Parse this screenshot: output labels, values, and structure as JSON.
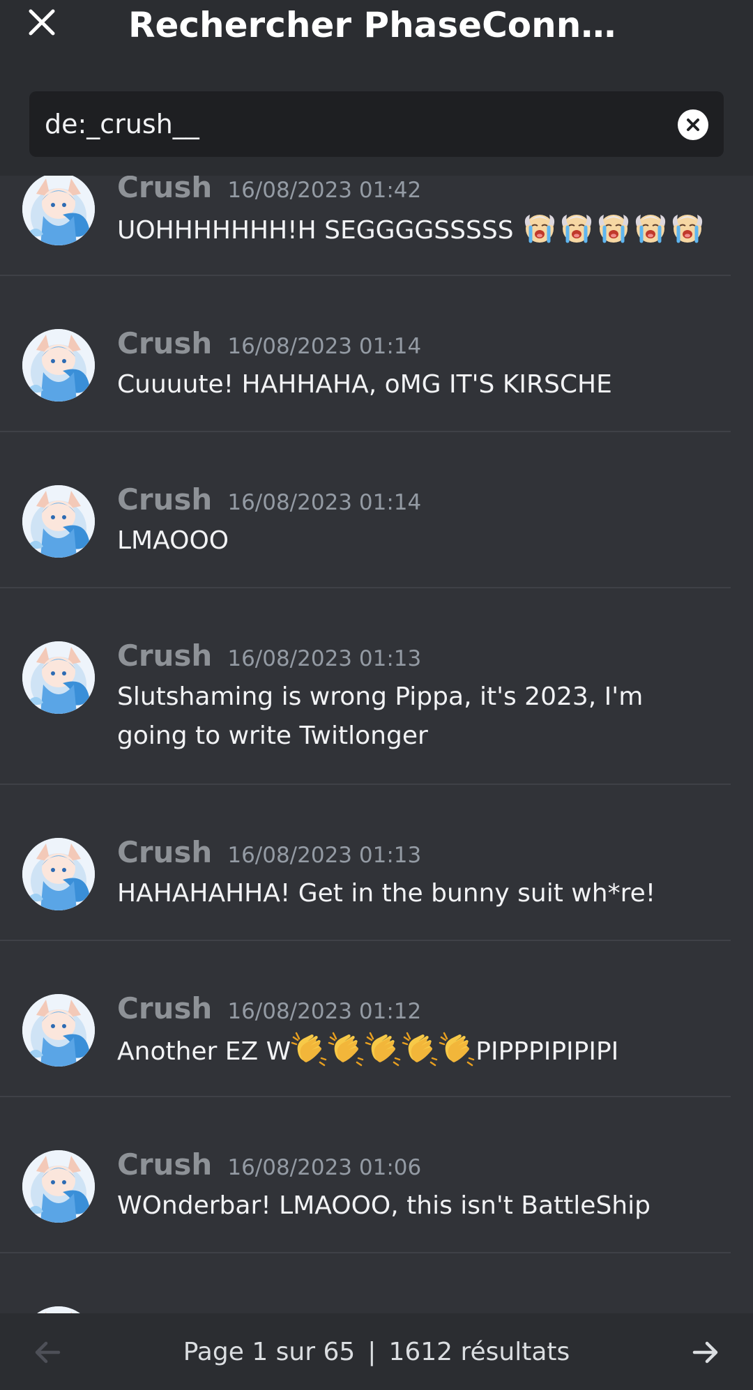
{
  "header": {
    "title": "Rechercher PhaseConnec...",
    "close_icon": "close-icon"
  },
  "search": {
    "value": "de:_crush__",
    "clear_icon": "clear-circle-icon"
  },
  "messages": [
    {
      "author": "Crush",
      "timestamp": "16/08/2023 01:42",
      "text": "UOHHHHHHH!H SEGGGGSSSSS",
      "emoji": "loudly-crying-face",
      "emoji_count": 5
    },
    {
      "author": "Crush",
      "timestamp": "16/08/2023 01:14",
      "text": "Cuuuute! HAHHAHA, oMG IT'S KIRSCHE"
    },
    {
      "author": "Crush",
      "timestamp": "16/08/2023 01:14",
      "text": "LMAOOO"
    },
    {
      "author": "Crush",
      "timestamp": "16/08/2023 01:13",
      "text": "Slutshaming is wrong Pippa, it's 2023, I'm going to write Twitlonger"
    },
    {
      "author": "Crush",
      "timestamp": "16/08/2023 01:13",
      "text": "HAHAHAHHA! Get in the bunny suit wh*re!"
    },
    {
      "author": "Crush",
      "timestamp": "16/08/2023 01:12",
      "text_before": "Another EZ W",
      "text_after": "PIPPPIPIPIPI",
      "emoji": "clapping-hands",
      "emoji_count": 5
    },
    {
      "author": "Crush",
      "timestamp": "16/08/2023 01:06",
      "text": "WOnderbar! LMAOOO, this isn't BattleShip"
    }
  ],
  "footer": {
    "page_label": "Page 1 sur 65",
    "separator": "|",
    "results_label": "1612 résultats",
    "prev_icon": "arrow-left-icon",
    "next_icon": "arrow-right-icon"
  },
  "colors": {
    "background": "#313338",
    "header_background": "#2b2d31",
    "search_background": "#1e1f22",
    "author": "#8e9297",
    "timestamp": "#949ba4",
    "message_text": "#f2f3f5",
    "divider": "#3f4147"
  }
}
